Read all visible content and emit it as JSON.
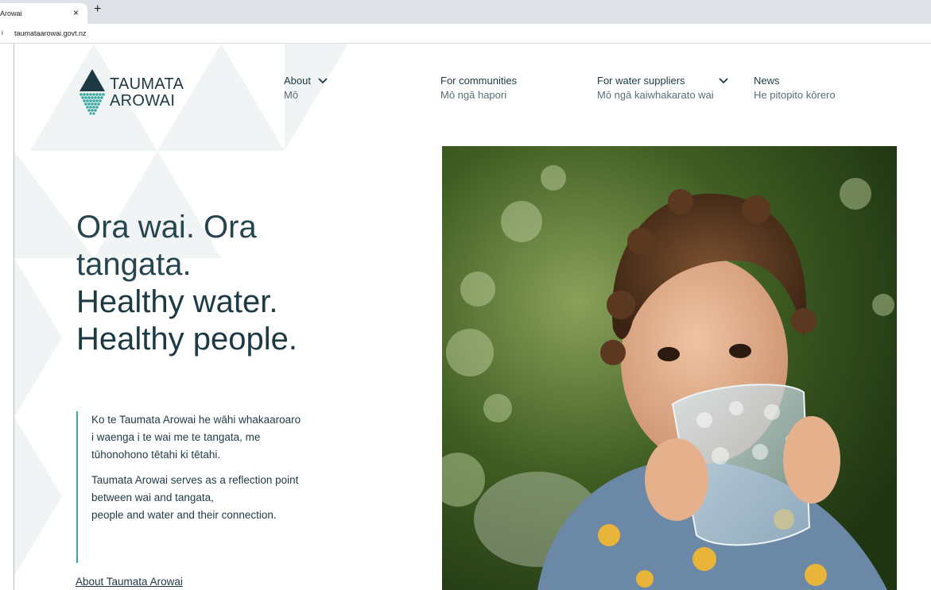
{
  "browser": {
    "tab_title": "Arowai",
    "tab_close": "×",
    "new_tab": "+",
    "address_icon": "i",
    "url": "taumataarowai.govt.nz"
  },
  "logo": {
    "line1": "TAUMATA",
    "line2": "AROWAI"
  },
  "nav": [
    {
      "en": "About",
      "mi": "Mō",
      "has_dropdown": true
    },
    {
      "en": "For communities",
      "mi": "Mō ngā hapori",
      "has_dropdown": false
    },
    {
      "en": "For water suppliers",
      "mi": "Mō ngā kaiwhakarato wai",
      "has_dropdown": true
    },
    {
      "en": "News",
      "mi": "He pitopito kōrero",
      "has_dropdown": false
    }
  ],
  "hero": {
    "mi_line1": "Ora wai. Ora",
    "mi_line2": "tangata.",
    "en_line1": "Healthy water.",
    "en_line2": "Healthy people."
  },
  "intro": {
    "mi_line1": "Ko te Taumata Arowai he wāhi whakaaroaro",
    "mi_line2": "i waenga i te wai me te tangata, me",
    "mi_line3": "tūhonohono tētahi ki tētahi.",
    "en_line1": "Taumata Arowai serves as a reflection point",
    "en_line2": "between wai and tangata,",
    "en_line3": "people and water and their connection."
  },
  "about_link": "About Taumata Arowai",
  "colors": {
    "text": "#1d3a44",
    "accent": "#3aa7a1",
    "background_triangles": "#f1f4f5"
  }
}
